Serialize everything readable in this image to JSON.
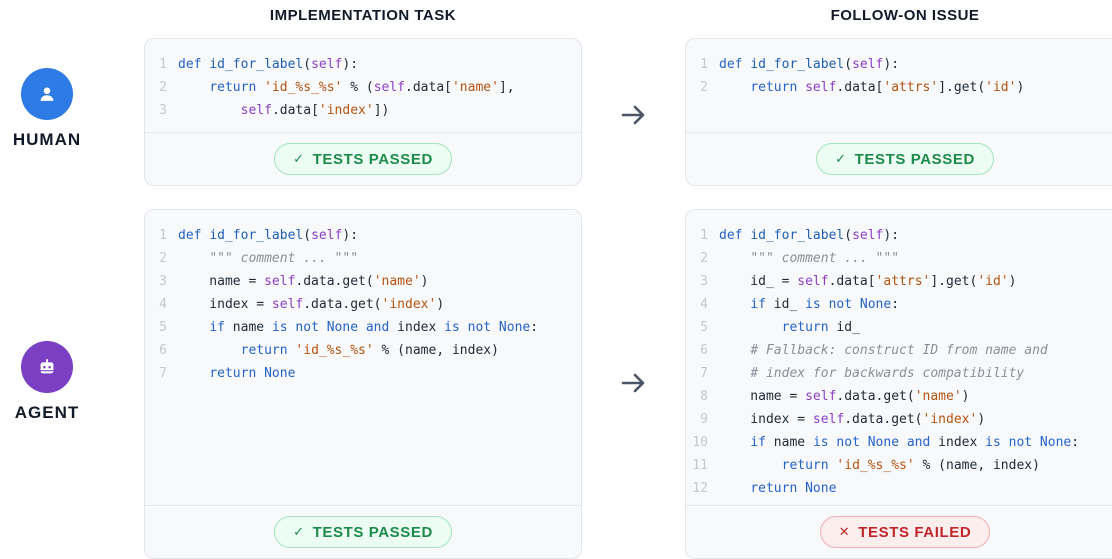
{
  "columns": {
    "left_title": "IMPLEMENTATION TASK",
    "right_title": "FOLLOW-ON ISSUE"
  },
  "rows": {
    "human": {
      "label": "HUMAN",
      "icon": "person-icon",
      "color": "#2f7be5"
    },
    "agent": {
      "label": "AGENT",
      "icon": "robot-icon",
      "color": "#7b3fc4"
    }
  },
  "colors": {
    "keyword": "#2563c9",
    "self": "#8a3fc7",
    "string": "#b4530f",
    "comment": "#8a8f98",
    "pass": "#1f8a4c",
    "fail": "#c0272d"
  },
  "panels": {
    "human_impl": {
      "code": [
        [
          [
            "kw",
            "def "
          ],
          [
            "fn",
            "id_for_label"
          ],
          [
            "p",
            "("
          ],
          [
            "self",
            "self"
          ],
          [
            "p",
            "):"
          ]
        ],
        [
          [
            "p",
            "    "
          ],
          [
            "kw",
            "return "
          ],
          [
            "str",
            "'id_%s_%s'"
          ],
          [
            "p",
            " % ("
          ],
          [
            "self",
            "self"
          ],
          [
            "p",
            ".data["
          ],
          [
            "str",
            "'name'"
          ],
          [
            "p",
            "],"
          ]
        ],
        [
          [
            "p",
            "        "
          ],
          [
            "self",
            "self"
          ],
          [
            "p",
            ".data["
          ],
          [
            "str",
            "'index'"
          ],
          [
            "p",
            "])"
          ]
        ]
      ],
      "result": {
        "status": "pass",
        "icon": "✓",
        "label": "TESTS PASSED"
      }
    },
    "human_followon": {
      "code": [
        [
          [
            "kw",
            "def "
          ],
          [
            "fn",
            "id_for_label"
          ],
          [
            "p",
            "("
          ],
          [
            "self",
            "self"
          ],
          [
            "p",
            "):"
          ]
        ],
        [
          [
            "p",
            "    "
          ],
          [
            "kw",
            "return "
          ],
          [
            "self",
            "self"
          ],
          [
            "p",
            ".data["
          ],
          [
            "str",
            "'attrs'"
          ],
          [
            "p",
            "].get("
          ],
          [
            "str",
            "'id'"
          ],
          [
            "p",
            ")"
          ]
        ]
      ],
      "result": {
        "status": "pass",
        "icon": "✓",
        "label": "TESTS PASSED"
      }
    },
    "agent_impl": {
      "code": [
        [
          [
            "kw",
            "def "
          ],
          [
            "fn",
            "id_for_label"
          ],
          [
            "p",
            "("
          ],
          [
            "self",
            "self"
          ],
          [
            "p",
            "):"
          ]
        ],
        [
          [
            "p",
            "    "
          ],
          [
            "com",
            "\"\"\" comment ... \"\"\""
          ]
        ],
        [
          [
            "p",
            "    name = "
          ],
          [
            "self",
            "self"
          ],
          [
            "p",
            ".data.get("
          ],
          [
            "str",
            "'name'"
          ],
          [
            "p",
            ")"
          ]
        ],
        [
          [
            "p",
            "    index = "
          ],
          [
            "self",
            "self"
          ],
          [
            "p",
            ".data.get("
          ],
          [
            "str",
            "'index'"
          ],
          [
            "p",
            ")"
          ]
        ],
        [
          [
            "p",
            "    "
          ],
          [
            "kw",
            "if "
          ],
          [
            "p",
            "name "
          ],
          [
            "kw",
            "is not None and "
          ],
          [
            "p",
            "index "
          ],
          [
            "kw",
            "is not None"
          ],
          [
            "p",
            ":"
          ]
        ],
        [
          [
            "p",
            "        "
          ],
          [
            "kw",
            "return "
          ],
          [
            "str",
            "'id_%s_%s'"
          ],
          [
            "p",
            " % (name, index)"
          ]
        ],
        [
          [
            "p",
            "    "
          ],
          [
            "kw",
            "return None"
          ]
        ]
      ],
      "result": {
        "status": "pass",
        "icon": "✓",
        "label": "TESTS PASSED"
      }
    },
    "agent_followon": {
      "code": [
        [
          [
            "kw",
            "def "
          ],
          [
            "fn",
            "id_for_label"
          ],
          [
            "p",
            "("
          ],
          [
            "self",
            "self"
          ],
          [
            "p",
            "):"
          ]
        ],
        [
          [
            "p",
            "    "
          ],
          [
            "com",
            "\"\"\" comment ... \"\"\""
          ]
        ],
        [
          [
            "p",
            "    id_ = "
          ],
          [
            "self",
            "self"
          ],
          [
            "p",
            ".data["
          ],
          [
            "str",
            "'attrs'"
          ],
          [
            "p",
            "].get("
          ],
          [
            "str",
            "'id'"
          ],
          [
            "p",
            ")"
          ]
        ],
        [
          [
            "p",
            "    "
          ],
          [
            "kw",
            "if "
          ],
          [
            "p",
            "id_ "
          ],
          [
            "kw",
            "is not None"
          ],
          [
            "p",
            ":"
          ]
        ],
        [
          [
            "p",
            "        "
          ],
          [
            "kw",
            "return "
          ],
          [
            "p",
            "id_"
          ]
        ],
        [
          [
            "p",
            "    "
          ],
          [
            "com",
            "# Fallback: construct ID from name and"
          ]
        ],
        [
          [
            "p",
            "    "
          ],
          [
            "com",
            "# index for backwards compatibility"
          ]
        ],
        [
          [
            "p",
            "    name = "
          ],
          [
            "self",
            "self"
          ],
          [
            "p",
            ".data.get("
          ],
          [
            "str",
            "'name'"
          ],
          [
            "p",
            ")"
          ]
        ],
        [
          [
            "p",
            "    index = "
          ],
          [
            "self",
            "self"
          ],
          [
            "p",
            ".data.get("
          ],
          [
            "str",
            "'index'"
          ],
          [
            "p",
            ")"
          ]
        ],
        [
          [
            "p",
            "    "
          ],
          [
            "kw",
            "if "
          ],
          [
            "p",
            "name "
          ],
          [
            "kw",
            "is not None and "
          ],
          [
            "p",
            "index "
          ],
          [
            "kw",
            "is not None"
          ],
          [
            "p",
            ":"
          ]
        ],
        [
          [
            "p",
            "        "
          ],
          [
            "kw",
            "return "
          ],
          [
            "str",
            "'id_%s_%s'"
          ],
          [
            "p",
            " % (name, index)"
          ]
        ],
        [
          [
            "p",
            "    "
          ],
          [
            "kw",
            "return None"
          ]
        ]
      ],
      "result": {
        "status": "fail",
        "icon": "✕",
        "label": "TESTS FAILED"
      }
    }
  }
}
